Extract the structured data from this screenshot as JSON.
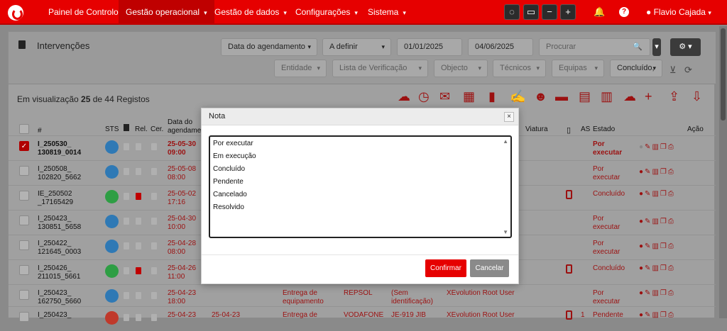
{
  "topbar": {
    "nav": [
      {
        "label": "Painel de Controlo",
        "caret": false
      },
      {
        "label": "Gestão operacional",
        "caret": true
      },
      {
        "label": "Gestão de dados",
        "caret": true
      },
      {
        "label": "Configurações",
        "caret": true
      },
      {
        "label": "Sistema",
        "caret": true
      }
    ],
    "user_name": "Flavio Cajada",
    "question_label": "?",
    "minus_label": "−",
    "plus_label": "+"
  },
  "page": {
    "title": "Intervenções",
    "filters": {
      "date_field": "Data do agendamento",
      "period": "A definir",
      "date_from": "01/01/2025",
      "date_to": "04/06/2025",
      "search_placeholder": "Procurar",
      "entity": "Entidade",
      "checklist": "Lista de Verificação",
      "object": "Objecto",
      "technicians": "Técnicos",
      "teams": "Equipas",
      "status": "Concluído,"
    },
    "count_prefix": "Em visualização",
    "count_shown": "25",
    "count_suffix": "de 44 Registos"
  },
  "table": {
    "headers": {
      "id": "#",
      "sts": "STS",
      "rel": "Rel.",
      "cer": "Cer.",
      "date_line1": "Data do",
      "date_line2": "agendamen",
      "vehicle": "Viatura",
      "as": "AS",
      "state": "Estado",
      "action": "Ação"
    },
    "rows": [
      {
        "id1": "I_250530_",
        "id2": "130819_0014",
        "d1": "25-05-30",
        "d2": "09:00",
        "st1": "Por",
        "st2": "executar",
        "dot": "#2f79b5",
        "checked": true,
        "bold": true,
        "phone": false,
        "rel": false
      },
      {
        "id1": "I_250508_",
        "id2": "102820_5662",
        "d1": "25-05-08",
        "d2": "08:00",
        "st1": "Por",
        "st2": "executar",
        "dot": "#2f79b5",
        "checked": false,
        "bold": false,
        "phone": false,
        "rel": false
      },
      {
        "id1": "IE_250502",
        "id2": "_17165429",
        "d1": "25-05-02",
        "d2": "17:16",
        "st1": "Concluído",
        "st2": "",
        "dot": "#2e9e44",
        "checked": false,
        "bold": false,
        "phone": true,
        "rel": true
      },
      {
        "id1": "I_250423_",
        "id2": "130851_5658",
        "d1": "25-04-30",
        "d2": "10:00",
        "st1": "Por",
        "st2": "executar",
        "dot": "#2f79b5",
        "checked": false,
        "bold": false,
        "phone": false,
        "rel": false
      },
      {
        "id1": "I_250422_",
        "id2": "121645_0003",
        "d1": "25-04-28",
        "d2": "08:00",
        "st1": "Por",
        "st2": "executar",
        "dot": "#2f79b5",
        "checked": false,
        "bold": false,
        "phone": false,
        "rel": false
      },
      {
        "id1": "I_250426_",
        "id2": "211015_5661",
        "d1": "25-04-26",
        "d2": "11:00",
        "st1": "Concluído",
        "st2": "",
        "dot": "#2e9e44",
        "checked": false,
        "bold": false,
        "phone": true,
        "rel": true
      },
      {
        "id1": "I_250423_",
        "id2": "162750_5660",
        "d1": "25-04-23",
        "d2": "18:00",
        "st1": "Por",
        "st2": "executar",
        "dot": "#2f79b5",
        "checked": false,
        "bold": false,
        "phone": false,
        "rel": false
      },
      {
        "id1": "I_250423_",
        "id2": "",
        "d1": "25-04-23",
        "d2": "",
        "st1": "Pendente",
        "st2": "",
        "dot": "#c0392b",
        "checked": false,
        "bold": false,
        "phone": true,
        "rel": false
      }
    ],
    "row7_extra": {
      "c1a": "Entrega de",
      "c1b": "equipamento",
      "c2": "REPSOL",
      "c3a": "(Sem",
      "c3b": "identificação)",
      "c4": "XEvolution Root User"
    },
    "row8_extra": {
      "date2": "25-04-23",
      "c1a": "Entrega de",
      "c2": "VODAFONE",
      "c3a": "JE-919 JIB",
      "c4": "XEvolution Root User",
      "as": "1"
    }
  },
  "modal": {
    "title": "Nota",
    "close_label": "×",
    "options": [
      "Por executar",
      "Em execução",
      "Concluído",
      "Pendente",
      "Cancelado",
      "Resolvido"
    ],
    "confirm_label": "Confirmar",
    "cancel_label": "Cancelar"
  },
  "colors": {
    "brand": "#e60000",
    "accent_dark": "#9b1010",
    "blue_status": "#2f79b5",
    "green_status": "#2e9e44",
    "red_status": "#c0392b"
  }
}
